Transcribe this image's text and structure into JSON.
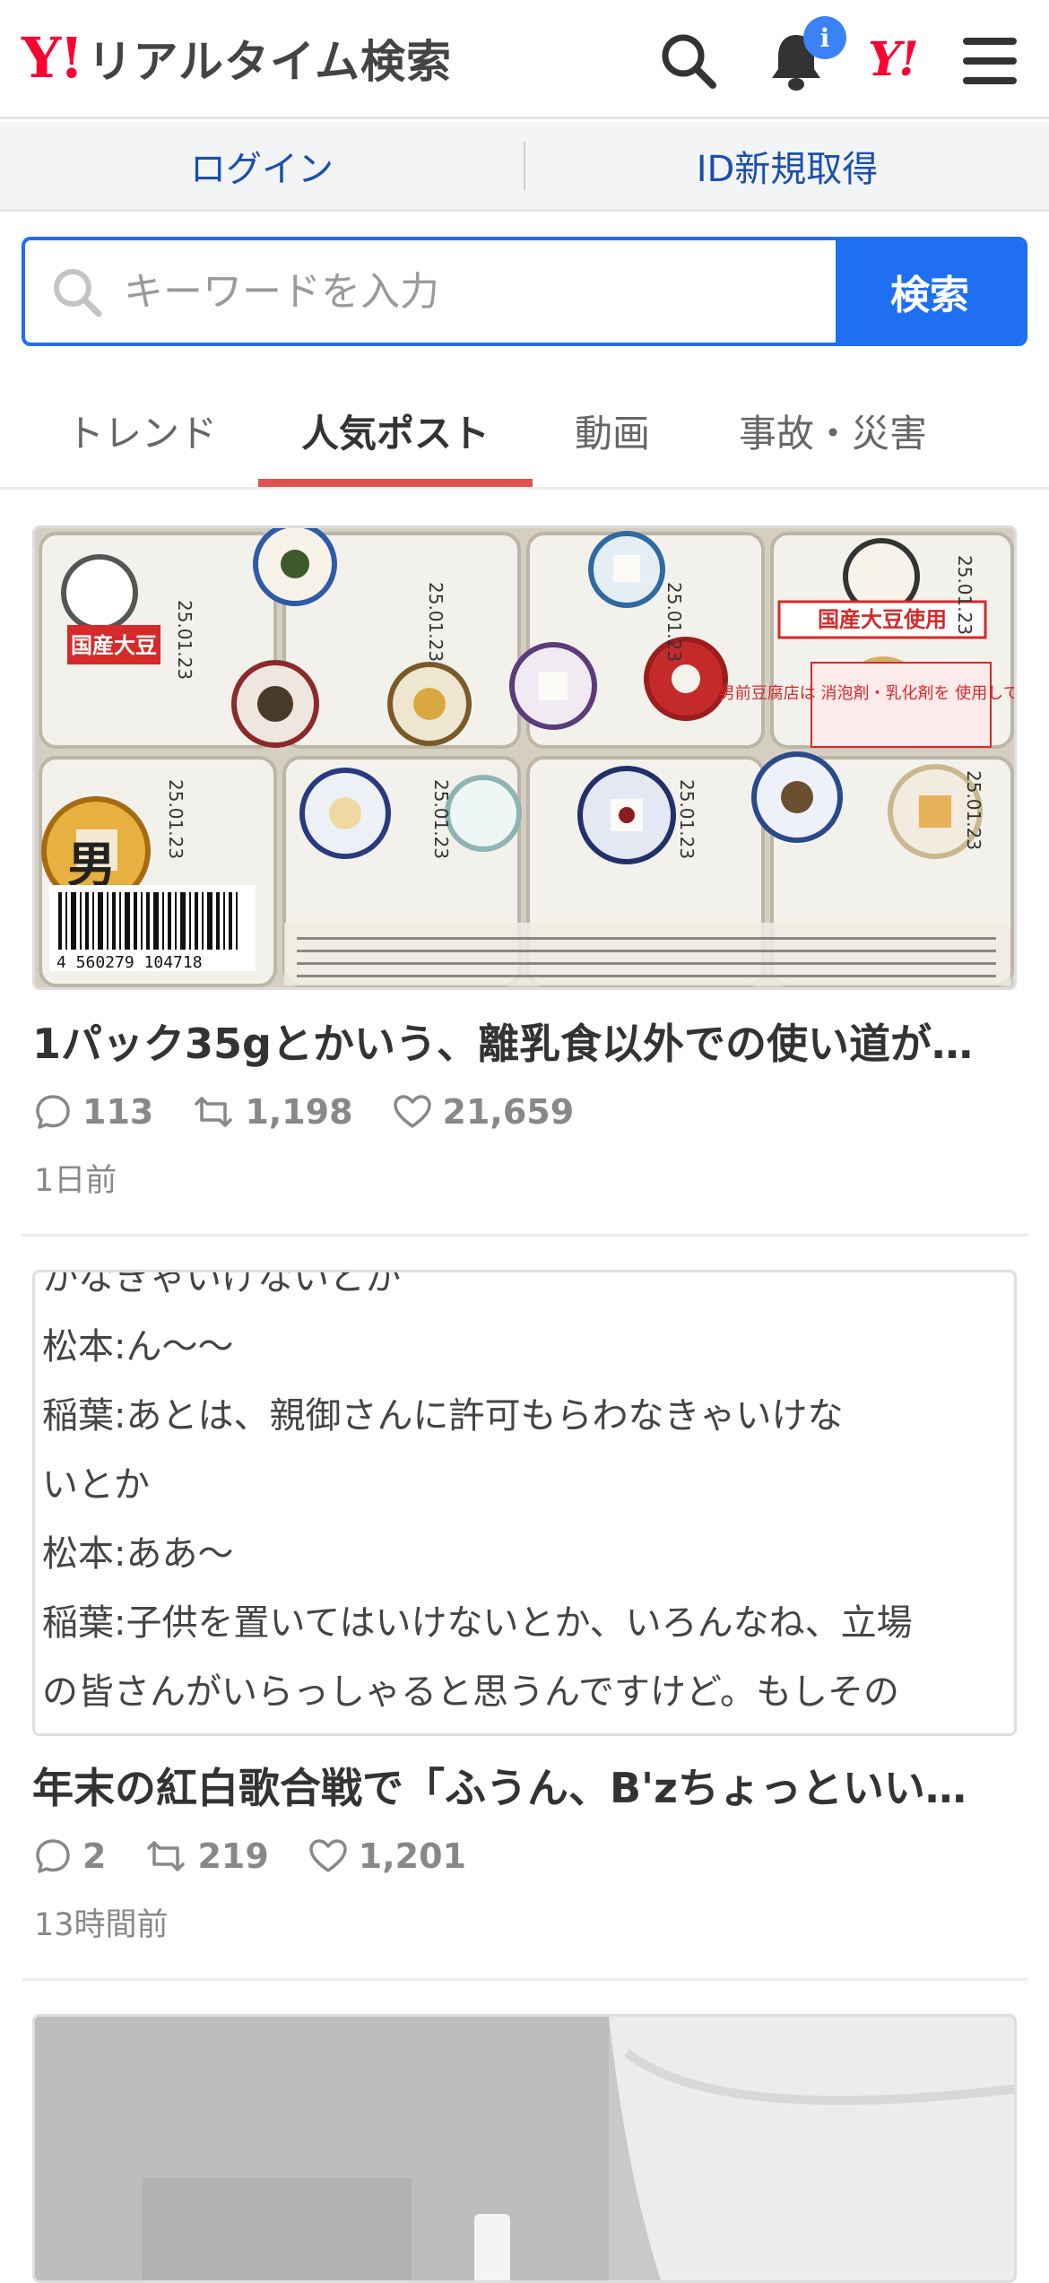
{
  "header": {
    "logo_mark": "Y!",
    "logo_text": "リアルタイム検索",
    "notification_badge": "i",
    "yahoo_mark": "Y!"
  },
  "loginbar": {
    "login": "ログイン",
    "signup": "ID新規取得"
  },
  "search": {
    "placeholder": "キーワードを入力",
    "button": "検索"
  },
  "tabs": [
    {
      "label": "トレンド",
      "active": false
    },
    {
      "label": "人気ポスト",
      "active": true
    },
    {
      "label": "動画",
      "active": false
    },
    {
      "label": "事故・災害",
      "active": false
    }
  ],
  "posts": [
    {
      "title": "1パック35gとかいう、離乳食以外での使い道が…",
      "replies": "113",
      "reposts": "1,198",
      "likes": "21,659",
      "time": "1日前",
      "image_texts": {
        "origin_badge": "国産大豆",
        "soy_badge": "国産大豆使用",
        "notice": "男前豆腐店は 消泡剤・乳化剤を 使用していません",
        "date": "25.01.23",
        "brand": "男",
        "barcode_number": "4 560279 104718"
      }
    },
    {
      "title": "年末の紅白歌合戦で「ふうん、B'zちょっといい…",
      "replies": "2",
      "reposts": "219",
      "likes": "1,201",
      "time": "13時間前",
      "image_lines": [
        "かなきゃいけないとか",
        "松本:ん〜〜",
        "稲葉:あとは、親御さんに許可もらわなきゃいけな",
        "いとか",
        "松本:ああ〜",
        "稲葉:子供を置いてはいけないとか、いろんなね、立場",
        "の皆さんがいらっしゃると思うんですけど。もしその"
      ]
    }
  ],
  "colors": {
    "brand_red": "#ff0033",
    "accent_blue": "#1e6ff2",
    "tab_underline": "#e0514f",
    "link_blue": "#1a4fb0"
  }
}
